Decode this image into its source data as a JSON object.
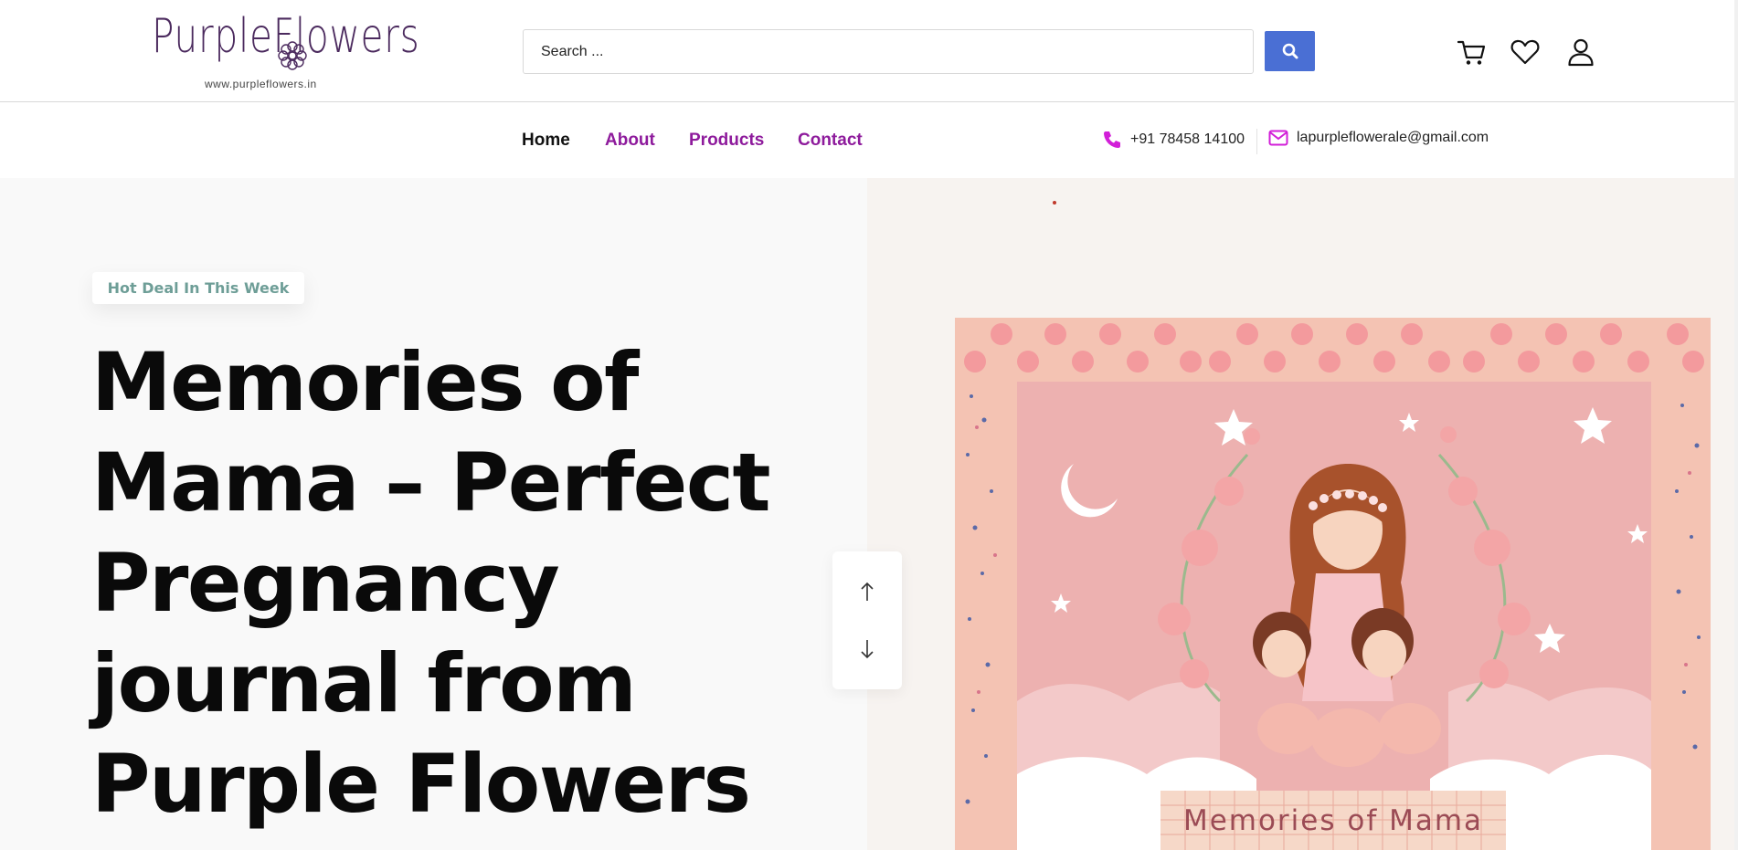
{
  "header": {
    "logo_text": "PurpleFlowers",
    "logo_url": "www.purpleflowers.in",
    "search_placeholder": "Search ...",
    "icons": [
      "search-icon",
      "cart-icon",
      "heart-icon",
      "user-icon"
    ]
  },
  "nav": {
    "items": [
      {
        "label": "Home",
        "active": true
      },
      {
        "label": "About",
        "active": false
      },
      {
        "label": "Products",
        "active": false
      },
      {
        "label": "Contact",
        "active": false
      }
    ],
    "phone": "+91 78458 14100",
    "email": "lapurpleflowerale@gmail.com"
  },
  "hero": {
    "badge": "Hot Deal In This Week",
    "title": "Memories of Mama – Perfect Pregnancy journal from Purple Flowers",
    "art_caption": "Memories of Mama"
  },
  "colors": {
    "brand_purple": "#8e1b9c",
    "search_button": "#4a6fd4",
    "badge_text": "#6e9e97",
    "contact_icon": "#d21fd8"
  }
}
